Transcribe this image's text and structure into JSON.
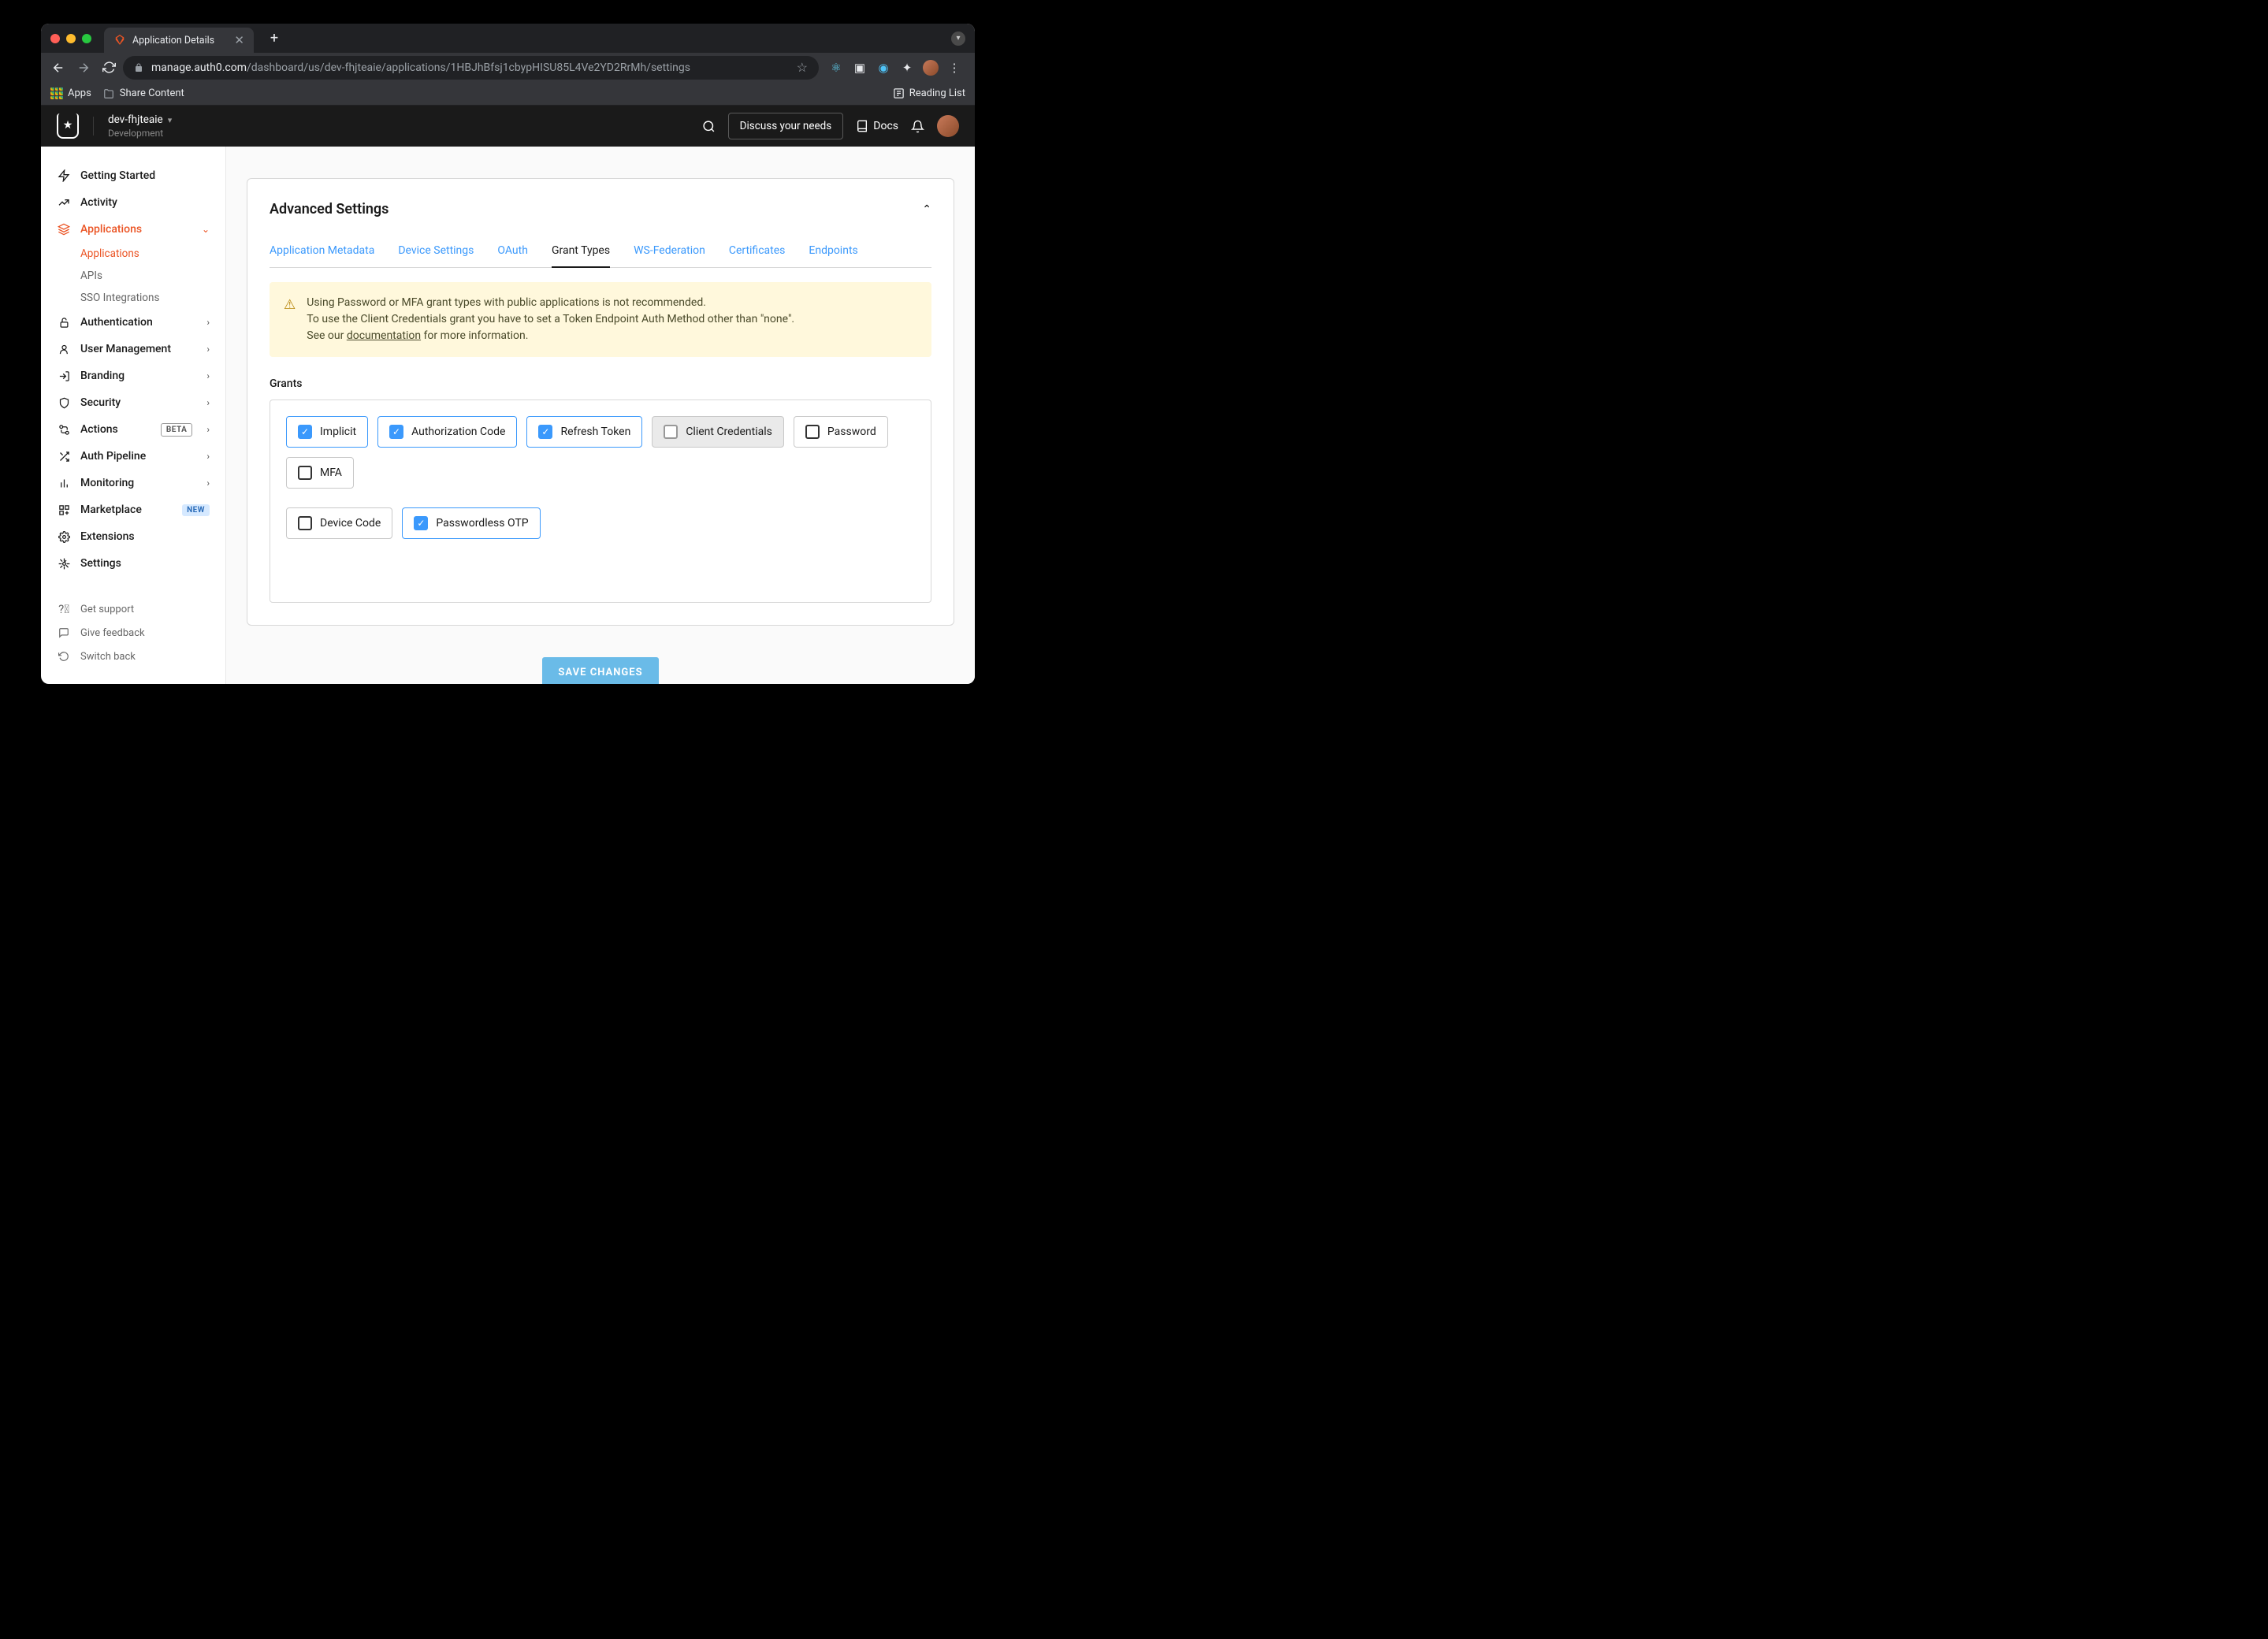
{
  "browser": {
    "tab_title": "Application Details",
    "url_domain": "manage.auth0.com",
    "url_path": "/dashboard/us/dev-fhjteaie/applications/1HBJhBfsj1cbypHISU85L4Ve2YD2RrMh/settings",
    "bookmarks": {
      "apps": "Apps",
      "share": "Share Content",
      "reading": "Reading List"
    }
  },
  "header": {
    "tenant_name": "dev-fhjteaie",
    "tenant_env": "Development",
    "discuss": "Discuss your needs",
    "docs": "Docs"
  },
  "sidebar": {
    "items": [
      {
        "label": "Getting Started"
      },
      {
        "label": "Activity"
      },
      {
        "label": "Applications"
      },
      {
        "label": "Authentication"
      },
      {
        "label": "User Management"
      },
      {
        "label": "Branding"
      },
      {
        "label": "Security"
      },
      {
        "label": "Actions",
        "badge": "BETA"
      },
      {
        "label": "Auth Pipeline"
      },
      {
        "label": "Monitoring"
      },
      {
        "label": "Marketplace",
        "badge": "NEW"
      },
      {
        "label": "Extensions"
      },
      {
        "label": "Settings"
      }
    ],
    "subs": [
      {
        "label": "Applications"
      },
      {
        "label": "APIs"
      },
      {
        "label": "SSO Integrations"
      }
    ],
    "bottom": [
      {
        "label": "Get support"
      },
      {
        "label": "Give feedback"
      },
      {
        "label": "Switch back"
      }
    ]
  },
  "panel": {
    "title": "Advanced Settings",
    "tabs": [
      "Application Metadata",
      "Device Settings",
      "OAuth",
      "Grant Types",
      "WS-Federation",
      "Certificates",
      "Endpoints"
    ],
    "warning_l1": "Using Password or MFA grant types with public applications is not recommended.",
    "warning_l2a": "To use the Client Credentials grant you have to set a Token Endpoint Auth Method other than \"none\".",
    "warning_l2b": "See our ",
    "warning_link": "documentation",
    "warning_l2c": " for more information.",
    "grants_label": "Grants",
    "grants": [
      {
        "label": "Implicit",
        "checked": true,
        "disabled": false
      },
      {
        "label": "Authorization Code",
        "checked": true,
        "disabled": false
      },
      {
        "label": "Refresh Token",
        "checked": true,
        "disabled": false
      },
      {
        "label": "Client Credentials",
        "checked": false,
        "disabled": true
      },
      {
        "label": "Password",
        "checked": false,
        "disabled": false
      },
      {
        "label": "MFA",
        "checked": false,
        "disabled": false
      },
      {
        "label": "Device Code",
        "checked": false,
        "disabled": false
      },
      {
        "label": "Passwordless OTP",
        "checked": true,
        "disabled": false
      }
    ],
    "save": "SAVE CHANGES"
  }
}
